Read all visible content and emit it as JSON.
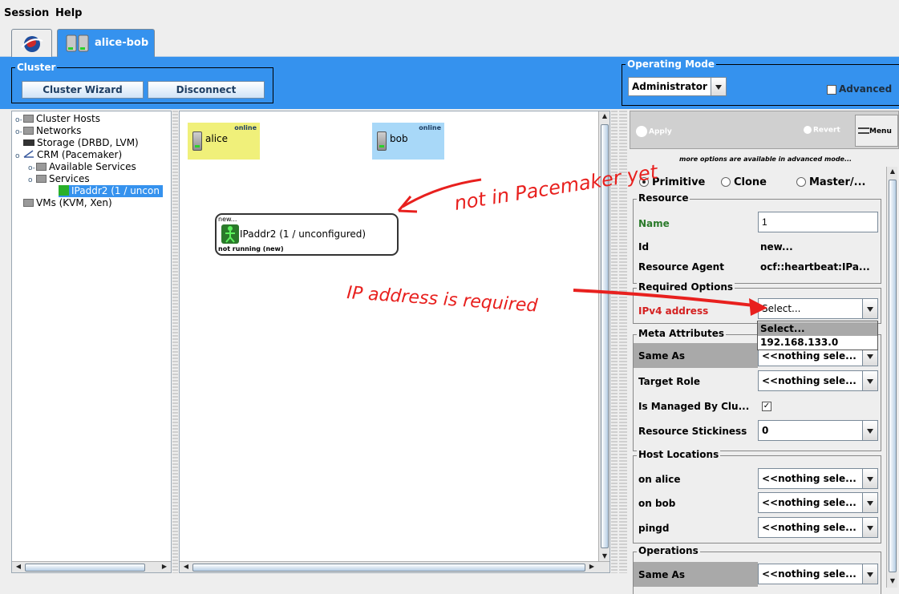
{
  "menu": {
    "session": "Session",
    "help": "Help"
  },
  "tabs": {
    "cluster_tab": "alice-bob"
  },
  "cluster_group": {
    "title": "Cluster",
    "wizard_button": "Cluster Wizard",
    "disconnect_button": "Disconnect"
  },
  "operating_mode": {
    "title": "Operating Mode",
    "selected": "Administrator",
    "advanced_label": "Advanced",
    "advanced_checked": false
  },
  "tree": {
    "items": [
      {
        "label": "Cluster Hosts"
      },
      {
        "label": "Networks"
      },
      {
        "label": "Storage (DRBD, LVM)"
      },
      {
        "label": "CRM (Pacemaker)"
      },
      {
        "label": "Available Services"
      },
      {
        "label": "Services"
      },
      {
        "label": "IPaddr2 (1 / uncon"
      },
      {
        "label": "VMs (KVM, Xen)"
      }
    ]
  },
  "graph": {
    "hosts": [
      {
        "name": "alice",
        "status": "online",
        "color": "#f0f07a"
      },
      {
        "name": "bob",
        "status": "online",
        "color": "#a8d8f8"
      }
    ],
    "resource": {
      "top_label": "new...",
      "name": "IPaddr2 (1 / unconfigured)",
      "status": "not running (new)"
    }
  },
  "toolbar": {
    "apply": "Apply",
    "revert": "Revert",
    "menu": "Menu"
  },
  "hint": "more options are available in advanced mode...",
  "resource_type": {
    "options": [
      "Primitive",
      "Clone",
      "Master/..."
    ],
    "selected": "Primitive"
  },
  "resource_section": {
    "title": "Resource",
    "name_label": "Name",
    "name_value": "1",
    "id_label": "Id",
    "id_value": "new...",
    "agent_label": "Resource Agent",
    "agent_value": "ocf::heartbeat:IPa..."
  },
  "required_options": {
    "title": "Required Options",
    "ipv4_label": "IPv4 address",
    "ipv4_value": "Select...",
    "dropdown_options": [
      "Select...",
      "192.168.133.0"
    ]
  },
  "meta_attributes": {
    "title": "Meta Attributes",
    "same_as_label": "Same As",
    "same_as_value": "<<nothing sele...",
    "target_role_label": "Target Role",
    "target_role_value": "<<nothing sele...",
    "managed_label": "Is Managed By Clu...",
    "managed_checked": true,
    "stickiness_label": "Resource Stickiness",
    "stickiness_value": "0"
  },
  "host_locations": {
    "title": "Host Locations",
    "rows": [
      {
        "label": "on alice",
        "value": "<<nothing sele..."
      },
      {
        "label": "on bob",
        "value": "<<nothing sele..."
      },
      {
        "label": "pingd",
        "value": "<<nothing sele..."
      }
    ]
  },
  "operations": {
    "title": "Operations",
    "same_as_label": "Same As",
    "same_as_value": "<<nothing sele..."
  },
  "annotations": {
    "not_in_pacemaker": "not in Pacemaker yet",
    "ip_required": "IP address is required",
    "color": "#e8201e"
  },
  "colors": {
    "accent_blue": "#3592ee",
    "required_red": "#d42020",
    "name_green": "#2a7a2a"
  }
}
